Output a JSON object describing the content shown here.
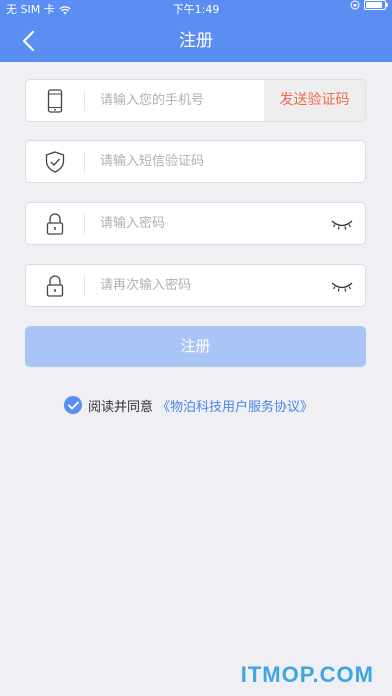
{
  "status_bar": {
    "carrier": "无 SIM 卡",
    "time": "下午1:49"
  },
  "nav": {
    "title": "注册",
    "back_icon": "chevron-left-icon"
  },
  "form": {
    "phone_placeholder": "请输入您的手机号",
    "send_code_label": "发送验证码",
    "sms_code_placeholder": "请输入短信验证码",
    "password_placeholder": "请输入密码",
    "confirm_password_placeholder": "请再次输入密码",
    "submit_label": "注册"
  },
  "agreement": {
    "text": "阅读并同意",
    "link": "《物泊科技用户服务协议》",
    "checked": true
  },
  "watermark": "ITMOP.COM",
  "colors": {
    "primary": "#5b8ef2",
    "button_disabled": "#abc4f6",
    "send_code_text": "#ef6a4d",
    "background": "#efeff4"
  }
}
